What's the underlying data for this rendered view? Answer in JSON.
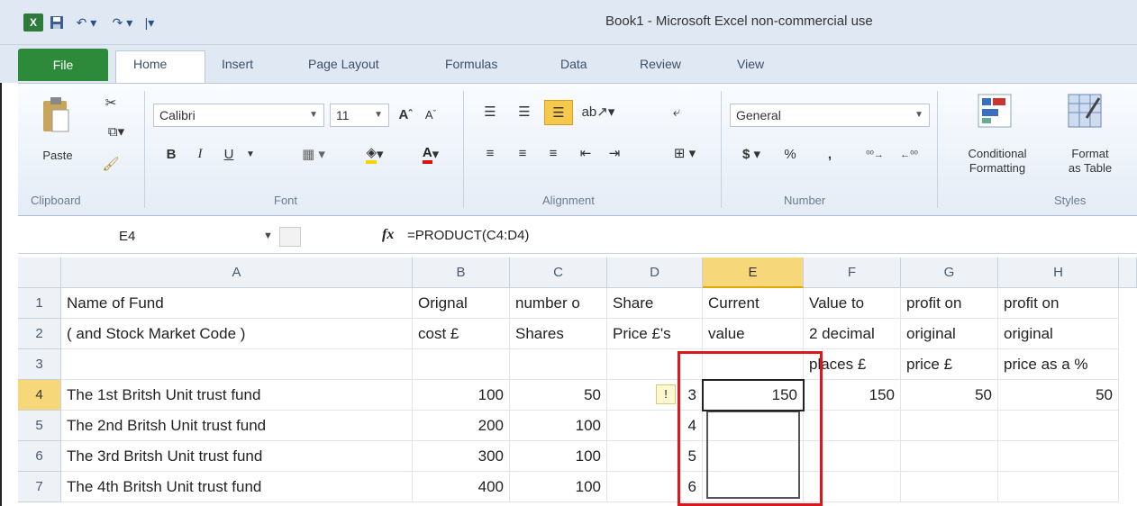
{
  "window": {
    "title": "Book1 - Microsoft Excel non-commercial use",
    "qat_icons": [
      "excel-icon",
      "save-icon",
      "undo-icon",
      "redo-icon",
      "customize-icon"
    ]
  },
  "ribbon": {
    "tabs": [
      "File",
      "Home",
      "Insert",
      "Page Layout",
      "Formulas",
      "Data",
      "Review",
      "View"
    ],
    "active_tab": "Home",
    "clipboard": {
      "paste_label": "Paste",
      "group_label": "Clipboard"
    },
    "font": {
      "name": "Calibri",
      "size": "11",
      "group_label": "Font",
      "bold": "B",
      "italic": "I",
      "underline": "U"
    },
    "alignment": {
      "group_label": "Alignment"
    },
    "number": {
      "format": "General",
      "group_label": "Number",
      "currency": "$",
      "percent": "%",
      "comma": ","
    },
    "styles": {
      "conditional_label": "Conditional\nFormatting",
      "format_table_label": "Format\nas Table",
      "group_label": "Styles"
    }
  },
  "formula_bar": {
    "name_box": "E4",
    "fx": "fx",
    "formula": "=PRODUCT(C4:D4)"
  },
  "grid": {
    "columns": [
      "A",
      "B",
      "C",
      "D",
      "E",
      "F",
      "G",
      "H"
    ],
    "selected_column": "E",
    "rows": [
      "1",
      "2",
      "3",
      "4",
      "5",
      "6",
      "7"
    ],
    "selected_row": "4",
    "cells": {
      "A1": "Name of Fund",
      "B1": "Orignal",
      "C1": "number o",
      "D1": "Share",
      "E1": "Current",
      "F1": "Value to",
      "G1": "profit on",
      "H1": "profit on",
      "A2": "( and Stock Market Code )",
      "B2": "cost  £",
      "C2": "Shares",
      "D2": "Price £'s",
      "E2": "value",
      "F2": "2 decimal",
      "G2": "original",
      "H2": "original",
      "F3": "places £",
      "G3": "price £",
      "H3": "price as a %",
      "A4": "The 1st Britsh Unit trust fund",
      "B4": "100",
      "C4": "50",
      "D4": "3",
      "E4": "150",
      "F4": "150",
      "G4": "50",
      "H4": "50",
      "A5": "The 2nd Britsh Unit trust fund",
      "B5": "200",
      "C5": "100",
      "D5": "4",
      "A6": "The 3rd Britsh Unit trust fund",
      "B6": "300",
      "C6": "100",
      "D6": "5",
      "A7": "The 4th Britsh Unit trust fund",
      "B7": "400",
      "C7": "100",
      "D7": "6"
    }
  },
  "colors": {
    "file_tab": "#2d8a3a",
    "selected_header": "#f6d77a",
    "highlight_box": "#e0141b"
  }
}
